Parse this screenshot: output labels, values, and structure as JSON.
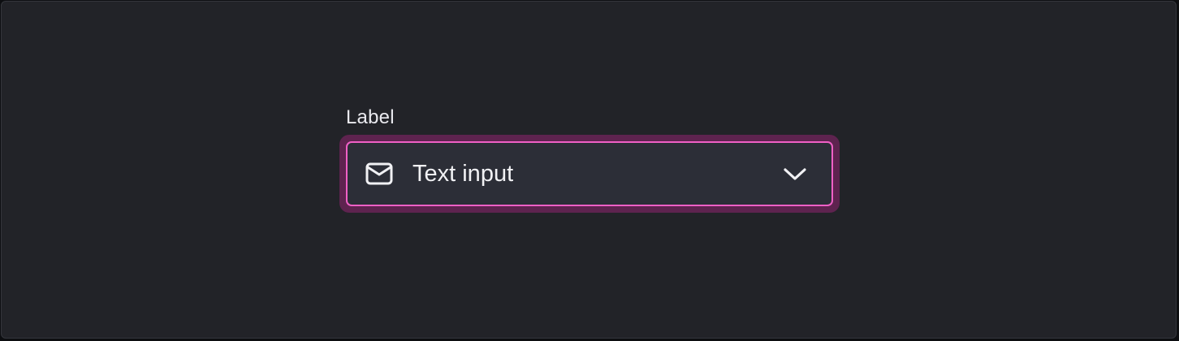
{
  "field": {
    "label": "Label",
    "value": "Text input",
    "leading_icon": "envelope-icon",
    "trailing_icon": "chevron-down-icon",
    "state": "focused"
  },
  "colors": {
    "background": "#222328",
    "input_background": "#2c2e37",
    "focus_border": "#f060c6",
    "focus_ring": "#5e234f",
    "text": "#f1f1f4"
  }
}
